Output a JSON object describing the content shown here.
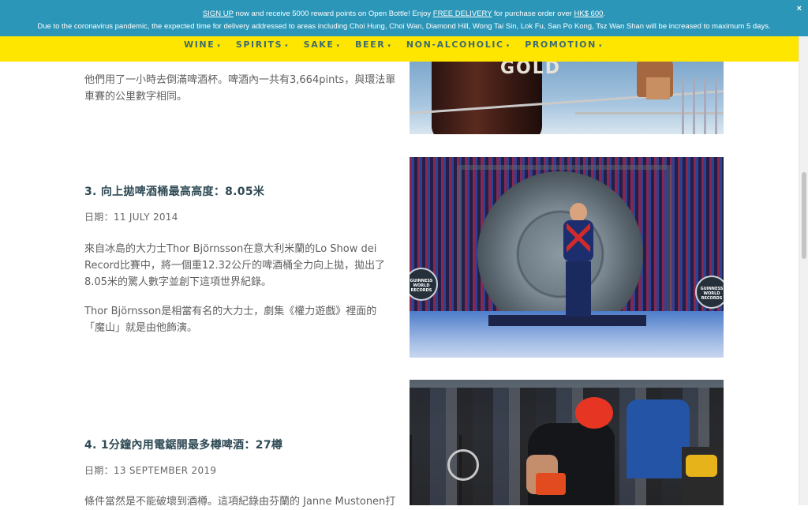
{
  "promo": {
    "signup_link": "SIGN UP",
    "line1_middle": " now and receive 5000 reward points on Open Bottle! Enjoy ",
    "free_delivery_link": "FREE DELIVERY",
    "line1_end": " for purchase order over ",
    "amount_link": "HK$ 600",
    "line1_tail": ".",
    "line2": "Due to the coronavirus pandemic, the expected time for delivery addressed to areas including Choi Hung, Choi Wan, Diamond Hill, Wong Tai Sin, Lok Fu, San Po Kong, Tsz Wan Shan will be increased to maximum 5 days.",
    "close_symbol": "×"
  },
  "nav": {
    "items": [
      {
        "label": "WINE"
      },
      {
        "label": "SPIRITS"
      },
      {
        "label": "SAKE"
      },
      {
        "label": "BEER"
      },
      {
        "label": "NON-ALCOHOLIC"
      },
      {
        "label": "PROMOTION"
      }
    ],
    "caret": "▾"
  },
  "article": {
    "intro_text": "他們用了一小時去倒滿啤酒杯。啤酒內一共有3,664pints，與環法單車賽的公里數字相同。",
    "image1_text": "GOLD",
    "section3": {
      "heading": "3. 向上拋啤酒桶最高高度：8.05米",
      "date": "日期：11 JULY 2014",
      "para1": "來自冰島的大力士Thor Björnsson在意大利米蘭的Lo Show dei Record比賽中，將一個重12.32公斤的啤酒桶全力向上拋，拋出了8.05米的驚人數字並創下這項世界紀錄。",
      "para2": "Thor Björnsson是相當有名的大力士，劇集《權力遊戲》裡面的「魔山」就是由他飾演。",
      "logo_text": "GUINNESS WORLD RECORDS"
    },
    "section4": {
      "heading": "4. 1分鐘內用電鋸開最多樽啤酒：27樽",
      "date": "日期：13 SEPTEMBER 2019",
      "para1": "條件當然是不能破壞到酒樽。這項紀錄由芬蘭的 Janne Mustonen打"
    }
  }
}
